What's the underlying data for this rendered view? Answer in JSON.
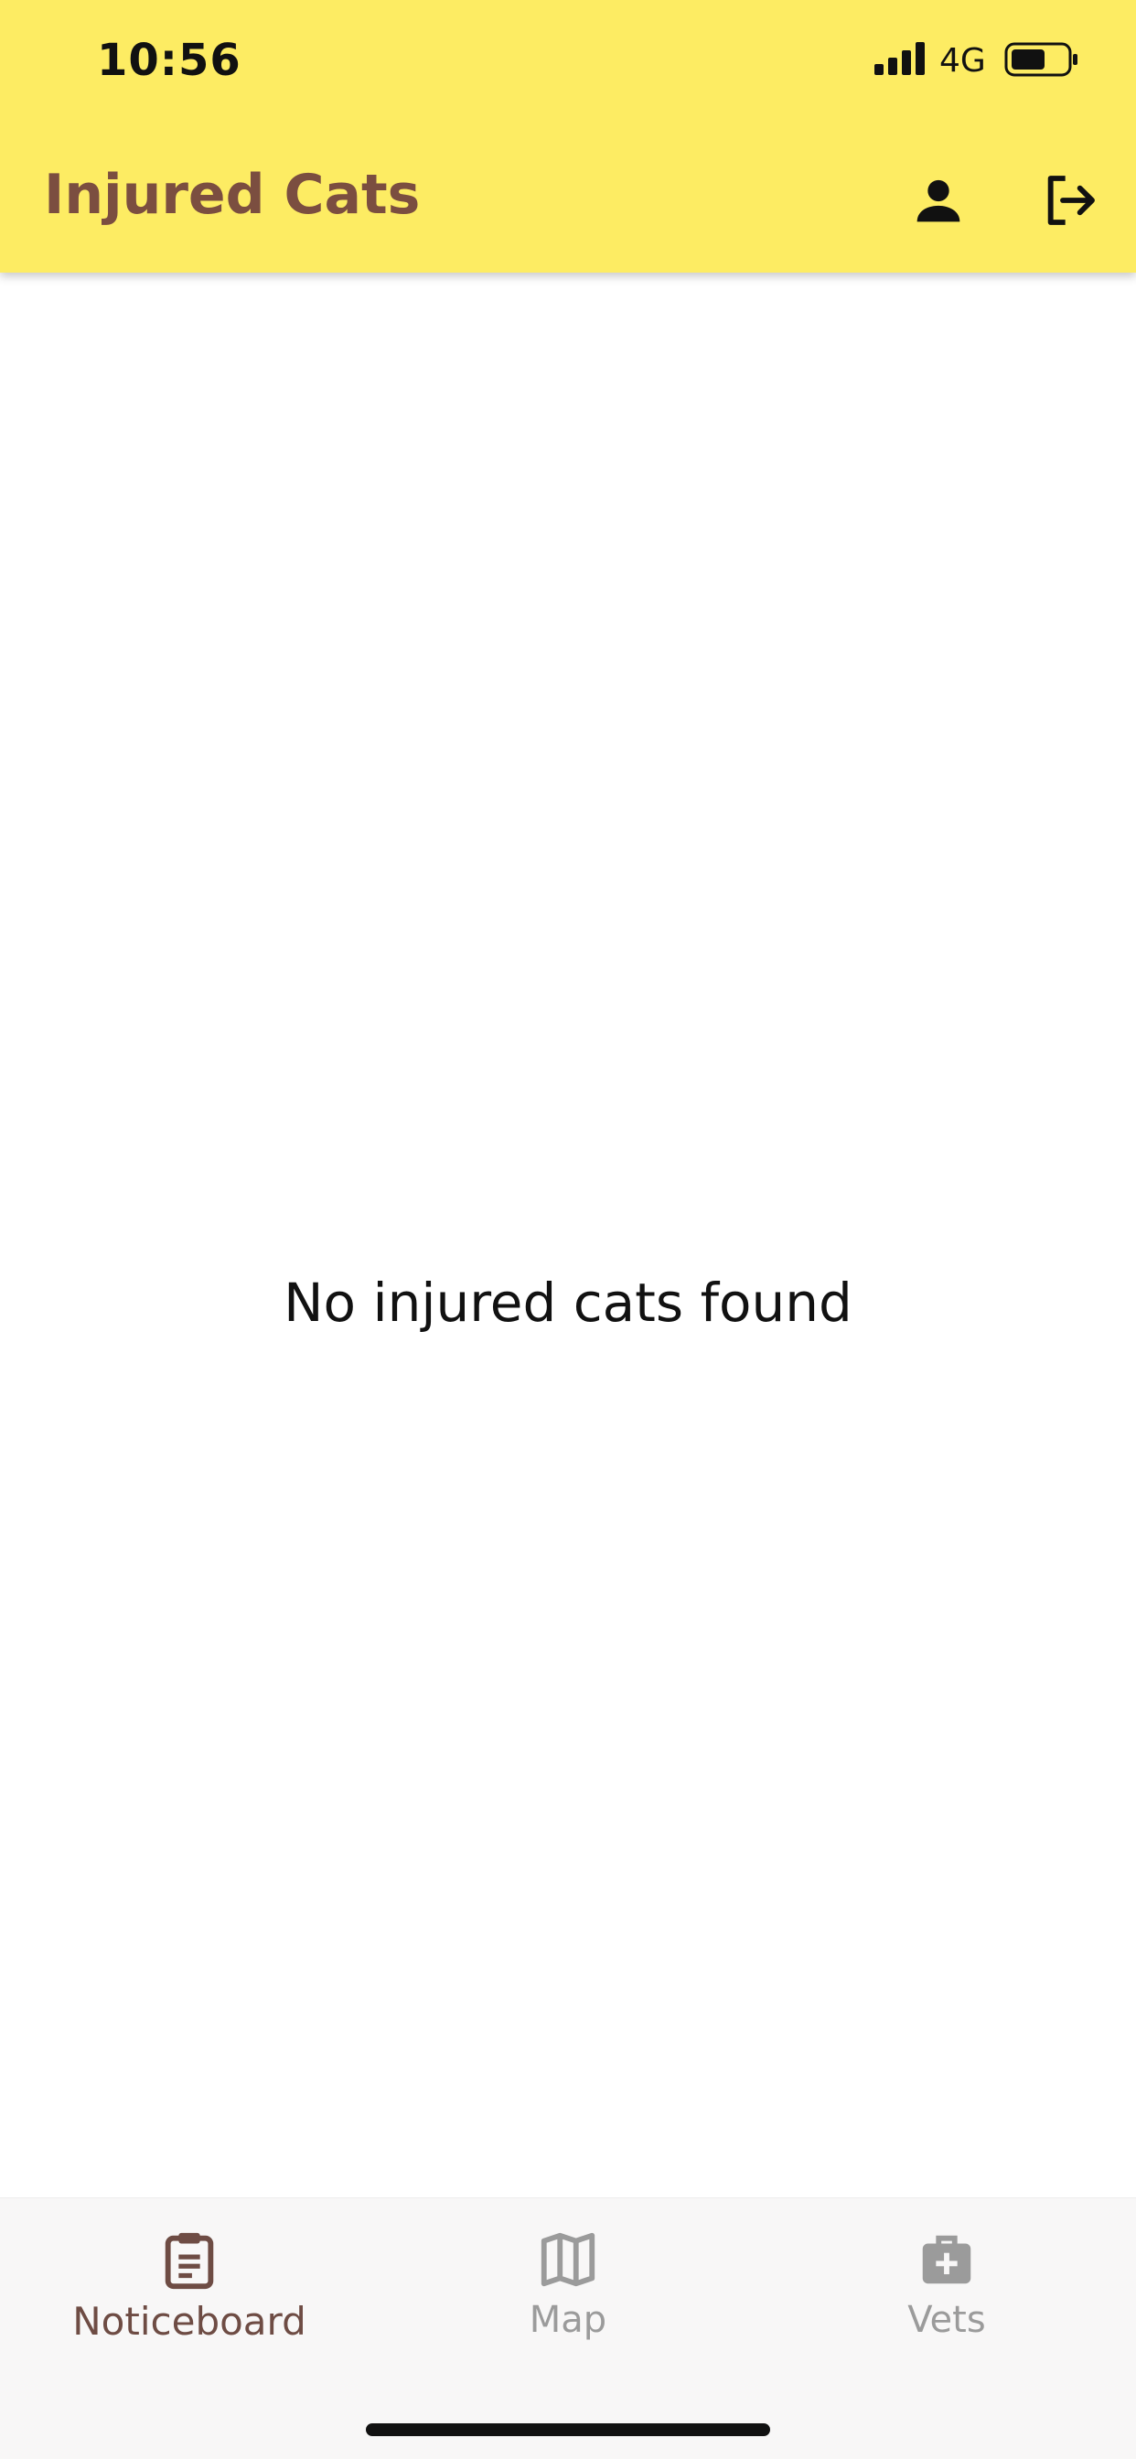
{
  "status_bar": {
    "time": "10:56",
    "network": "4G",
    "signal_icon": "signal-bars-icon",
    "battery_icon": "battery-icon"
  },
  "app_bar": {
    "title": "Injured Cats",
    "background": "#fdec63",
    "title_color": "#7b4e40",
    "actions": [
      {
        "name": "profile",
        "icon": "person-icon"
      },
      {
        "name": "logout",
        "icon": "logout-icon"
      }
    ]
  },
  "main": {
    "empty_message": "No injured cats found"
  },
  "bottom_nav": {
    "items": [
      {
        "label": "Noticeboard",
        "icon": "clipboard-icon",
        "active": true
      },
      {
        "label": "Map",
        "icon": "map-icon",
        "active": false
      },
      {
        "label": "Vets",
        "icon": "medical-kit-icon",
        "active": false
      }
    ],
    "active_color": "#6e4c44",
    "inactive_color": "#9b9b9b"
  }
}
